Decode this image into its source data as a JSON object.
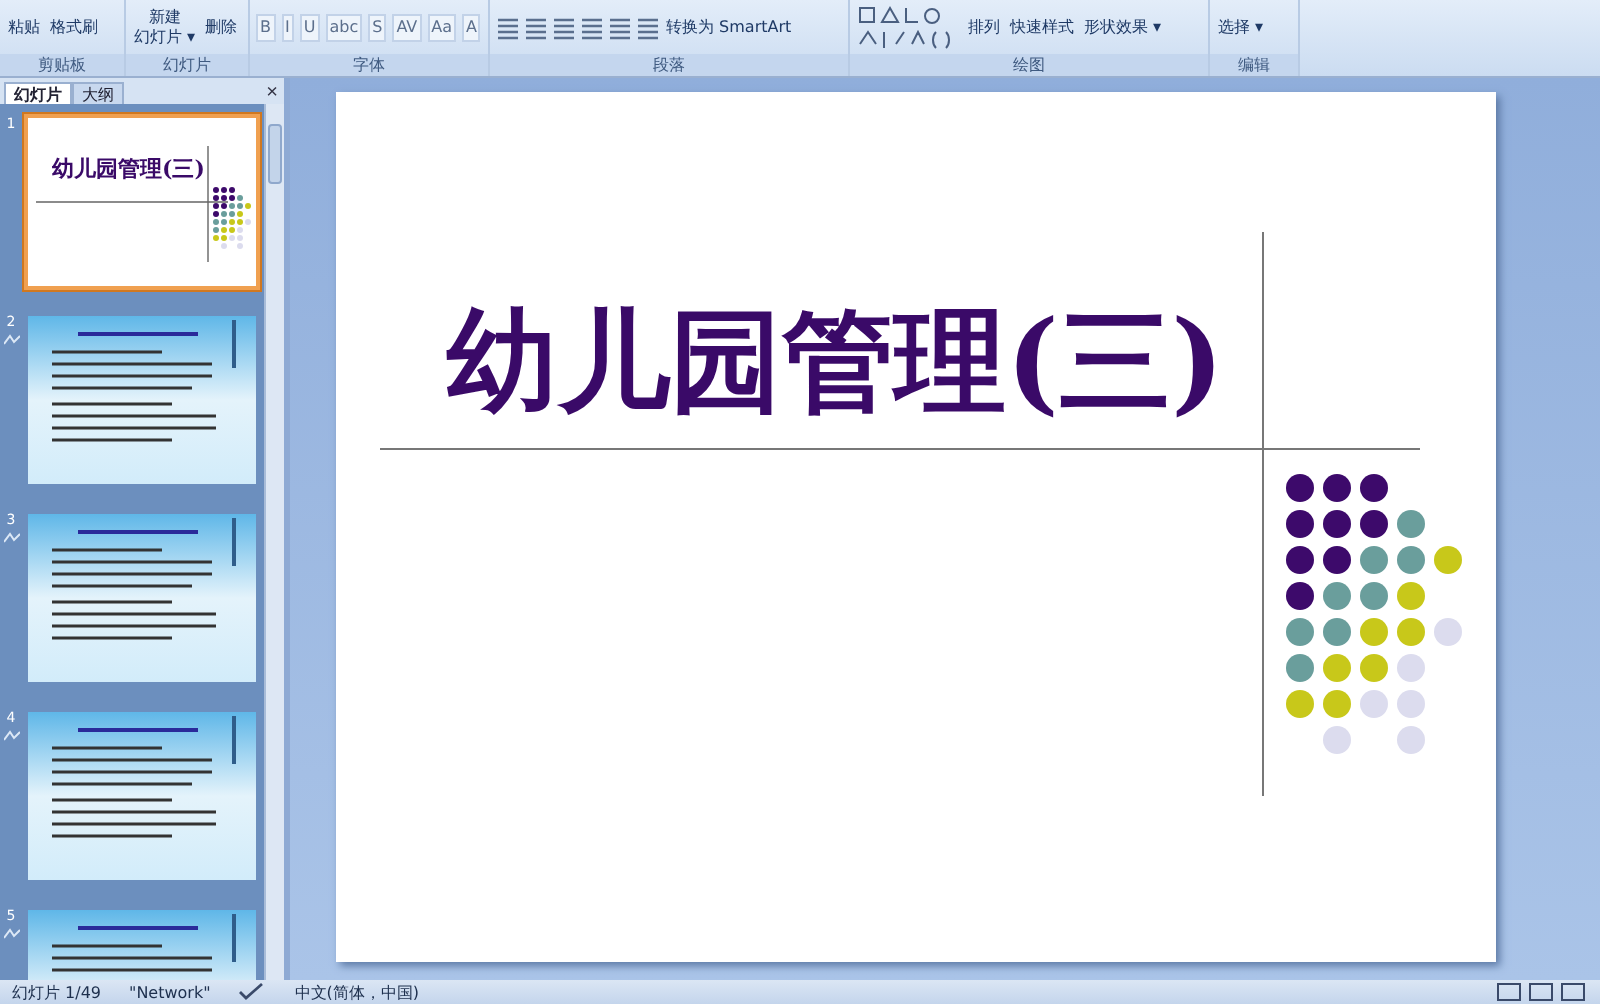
{
  "ribbon": {
    "groups": [
      {
        "label": "剪贴板",
        "items": [
          {
            "kind": "large",
            "lines": [
              "粘贴"
            ]
          },
          {
            "kind": "small",
            "label": "格式刷"
          }
        ]
      },
      {
        "label": "幻灯片",
        "items": [
          {
            "kind": "large",
            "lines": [
              "新建",
              "幻灯片 ▾"
            ]
          },
          {
            "kind": "small",
            "label": "删除"
          }
        ]
      },
      {
        "label": "字体",
        "items": [
          {
            "kind": "fmt",
            "label": "B"
          },
          {
            "kind": "fmt",
            "label": "I"
          },
          {
            "kind": "fmt",
            "label": "U"
          },
          {
            "kind": "fmt",
            "label": "abc"
          },
          {
            "kind": "fmt",
            "label": "S"
          },
          {
            "kind": "fmt",
            "label": "AV"
          },
          {
            "kind": "fmt",
            "label": "Aa"
          },
          {
            "kind": "fmt",
            "label": "A"
          }
        ]
      },
      {
        "label": "段落",
        "items": [
          {
            "kind": "align"
          },
          {
            "kind": "align"
          },
          {
            "kind": "align"
          },
          {
            "kind": "align"
          },
          {
            "kind": "align"
          },
          {
            "kind": "align"
          },
          {
            "kind": "small",
            "label": "转换为 SmartArt"
          }
        ]
      },
      {
        "label": "绘图",
        "items": [
          {
            "kind": "shapes"
          },
          {
            "kind": "large",
            "lines": [
              "排列"
            ]
          },
          {
            "kind": "large",
            "lines": [
              "快速样式"
            ]
          },
          {
            "kind": "small",
            "label": "形状效果 ▾"
          }
        ]
      },
      {
        "label": "编辑",
        "items": [
          {
            "kind": "small",
            "label": "选择 ▾"
          }
        ]
      }
    ]
  },
  "pane": {
    "tabs": [
      {
        "label": "幻灯片",
        "selected": true
      },
      {
        "label": "大纲",
        "selected": false
      }
    ],
    "close": "×",
    "thumbnails": [
      {
        "number": "1",
        "kind": "title",
        "title": "幼儿园管理(三)",
        "selected": true
      },
      {
        "number": "2",
        "kind": "text",
        "selected": false
      },
      {
        "number": "3",
        "kind": "text",
        "selected": false
      },
      {
        "number": "4",
        "kind": "text",
        "selected": false
      },
      {
        "number": "5",
        "kind": "text",
        "selected": false
      }
    ]
  },
  "slide": {
    "title": "幼儿园管理(三)",
    "dot_rows": [
      [
        {
          "kind": "dot",
          "color": "#3d0a6b"
        },
        {
          "kind": "dot",
          "color": "#3d0a6b"
        },
        {
          "kind": "dot",
          "color": "#3d0a6b"
        }
      ],
      [
        {
          "kind": "dot",
          "color": "#3d0a6b"
        },
        {
          "kind": "dot",
          "color": "#3d0a6b"
        },
        {
          "kind": "dot",
          "color": "#3d0a6b"
        },
        {
          "kind": "dot",
          "color": "#6a9e9c"
        }
      ],
      [
        {
          "kind": "dot",
          "color": "#3d0a6b"
        },
        {
          "kind": "dot",
          "color": "#3d0a6b"
        },
        {
          "kind": "dot",
          "color": "#6a9e9c"
        },
        {
          "kind": "dot",
          "color": "#6a9e9c"
        },
        {
          "kind": "dot",
          "color": "#c8c81a"
        }
      ],
      [
        {
          "kind": "dot",
          "color": "#3d0a6b"
        },
        {
          "kind": "dot",
          "color": "#6a9e9c"
        },
        {
          "kind": "dot",
          "color": "#6a9e9c"
        },
        {
          "kind": "dot",
          "color": "#c8c81a"
        }
      ],
      [
        {
          "kind": "dot",
          "color": "#6a9e9c"
        },
        {
          "kind": "dot",
          "color": "#6a9e9c"
        },
        {
          "kind": "dot",
          "color": "#c8c81a"
        },
        {
          "kind": "dot",
          "color": "#c8c81a"
        },
        {
          "kind": "dot",
          "color": "#dcdcee"
        }
      ],
      [
        {
          "kind": "dot",
          "color": "#6a9e9c"
        },
        {
          "kind": "dot",
          "color": "#c8c81a"
        },
        {
          "kind": "dot",
          "color": "#c8c81a"
        },
        {
          "kind": "dot",
          "color": "#dcdcee"
        }
      ],
      [
        {
          "kind": "dot",
          "color": "#c8c81a"
        },
        {
          "kind": "dot",
          "color": "#c8c81a"
        },
        {
          "kind": "dot",
          "color": "#dcdcee"
        },
        {
          "kind": "dot",
          "color": "#dcdcee"
        }
      ],
      [
        {
          "kind": "gap"
        },
        {
          "kind": "dot",
          "color": "#dcdcee"
        },
        {
          "kind": "gap"
        },
        {
          "kind": "dot",
          "color": "#dcdcee"
        }
      ]
    ]
  },
  "status_bar": {
    "slide": "幻灯片 1/49",
    "theme": "\"Network\"",
    "language": "中文(简体，中国)"
  }
}
